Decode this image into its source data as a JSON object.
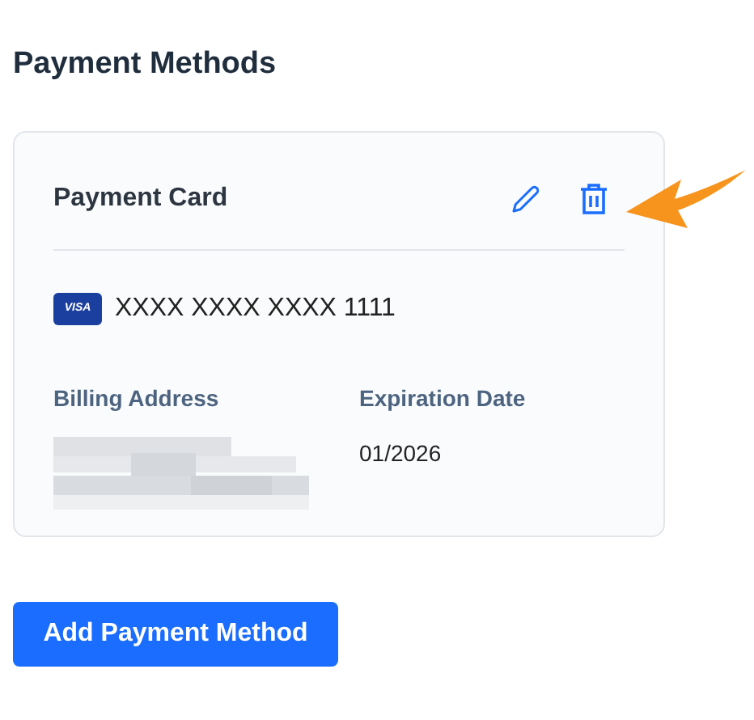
{
  "page_title": "Payment Methods",
  "card": {
    "title": "Payment Card",
    "brand": "VISA",
    "number": "XXXX XXXX XXXX 1111",
    "fields": [
      {
        "label": "Billing Address",
        "kind": "redacted"
      },
      {
        "label": "Expiration Date",
        "kind": "text",
        "value": "01/2026"
      }
    ]
  },
  "add_button": "Add Payment Method"
}
